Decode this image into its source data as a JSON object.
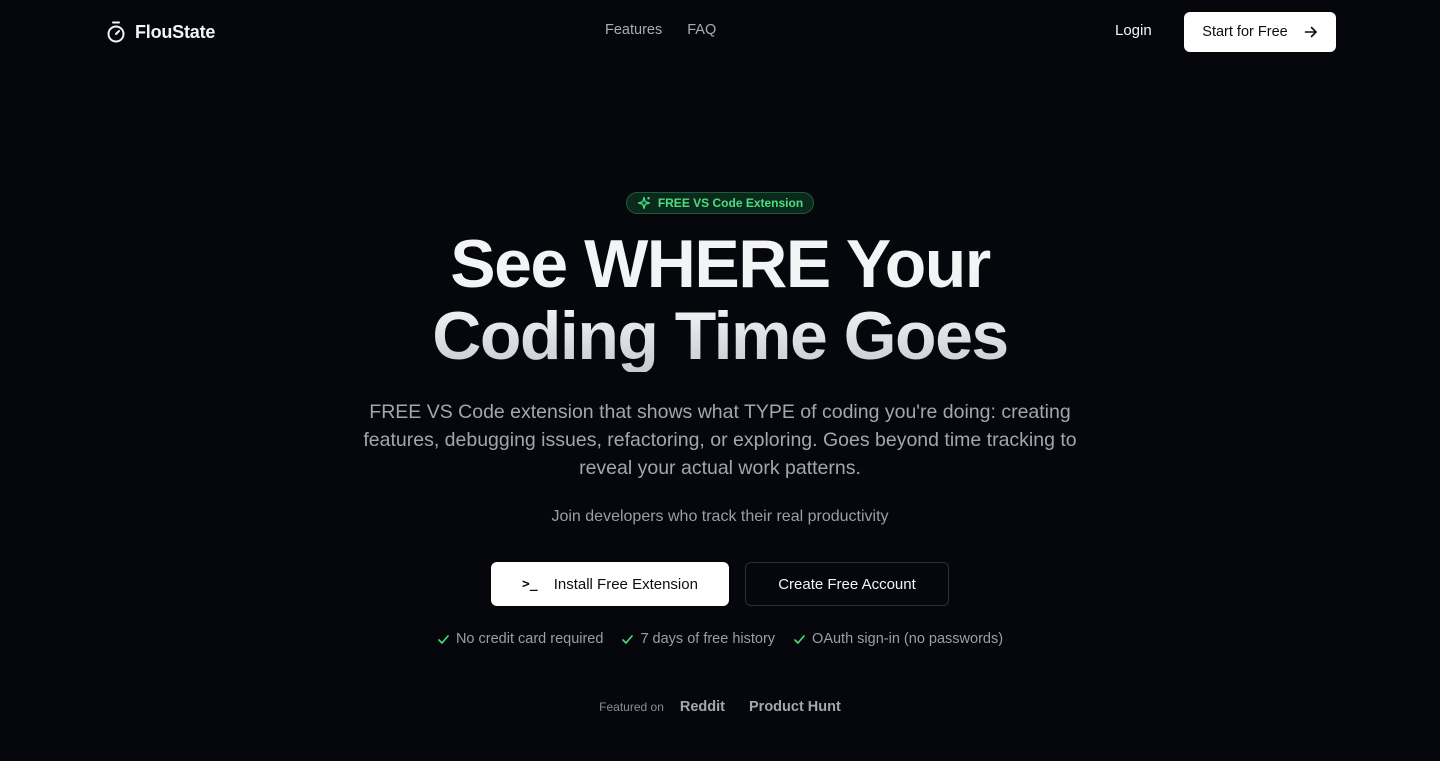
{
  "header": {
    "brand": "FlouState",
    "nav": [
      {
        "label": "Features"
      },
      {
        "label": "FAQ"
      }
    ],
    "login_label": "Login",
    "start_label": "Start for Free"
  },
  "hero": {
    "badge": "FREE VS Code Extension",
    "headline_line1": "See WHERE Your",
    "headline_line2": "Coding Time Goes",
    "subtitle": "FREE VS Code extension that shows what TYPE of coding you're doing: creating features, debugging issues, refactoring, or exploring. Goes beyond time tracking to reveal your actual work patterns.",
    "join_text": "Join developers who track their real productivity",
    "install_label": "Install Free Extension",
    "install_icon": ">_",
    "create_label": "Create Free Account",
    "checks": [
      {
        "label": "No credit card required"
      },
      {
        "label": "7 days of free history"
      },
      {
        "label": "OAuth sign-in (no passwords)"
      }
    ],
    "featured_label": "Featured on",
    "featured_links": [
      {
        "label": "Reddit"
      },
      {
        "label": "Product Hunt"
      }
    ]
  },
  "colors": {
    "background": "#05070d",
    "accent_green": "#4ade80",
    "button_white": "#ffffff"
  },
  "icons": {
    "logo": "stopwatch-icon",
    "badge": "sparkles-icon",
    "start": "arrow-right-icon",
    "check": "check-icon"
  }
}
